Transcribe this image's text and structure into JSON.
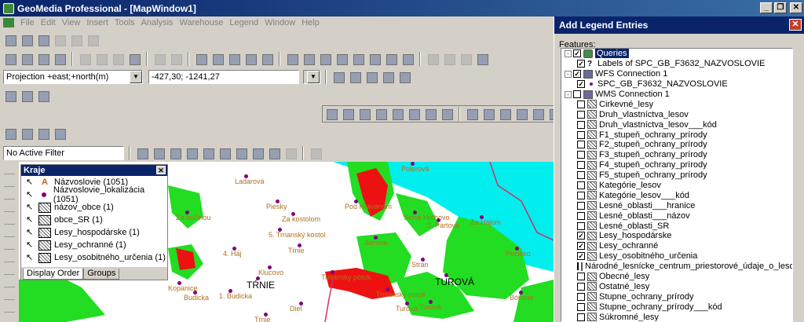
{
  "titlebar": {
    "title": "GeoMedia Professional - [MapWindow1]"
  },
  "menu": [
    "File",
    "Edit",
    "View",
    "Insert",
    "Tools",
    "Analysis",
    "Warehouse",
    "Legend",
    "Window",
    "Help"
  ],
  "coord": {
    "system": "Projection +east;+north(m)",
    "value": "-427,30; -1241,27"
  },
  "filter": {
    "label": "No Active Filter"
  },
  "legend": {
    "title": "Kraje",
    "items": [
      {
        "label": "Názvoslovie (1051)",
        "sym": "A"
      },
      {
        "label": "Názvoslovie_lokalizácia (1051)",
        "sym": ""
      },
      {
        "label": "názov_obce (1)",
        "sym": ""
      },
      {
        "label": "obce_SR (1)",
        "sym": ""
      },
      {
        "label": "Lesy_hospodárske (1)",
        "sym": ""
      },
      {
        "label": "Lesy_ochranné (1)",
        "sym": ""
      },
      {
        "label": "Lesy_osobitného_určenia (1)",
        "sym": ""
      }
    ],
    "tabs": [
      "Display Order",
      "Groups"
    ]
  },
  "map_labels": [
    {
      "t": "Polerová"
    },
    {
      "t": "Ladarová"
    },
    {
      "t": "Piesky"
    },
    {
      "t": "Za bučinou"
    },
    {
      "t": "Za kostolom"
    },
    {
      "t": "Pod Hravanom"
    },
    {
      "t": "Selce Hrchovo"
    },
    {
      "t": "2. Partova"
    },
    {
      "t": "Za Hájom"
    },
    {
      "t": "5. Trnanský kostol"
    },
    {
      "t": "Tŕnie"
    },
    {
      "t": "Jamina"
    },
    {
      "t": "4. Háj"
    },
    {
      "t": "Klucovo"
    },
    {
      "t": "TŔNIE"
    },
    {
      "t": "Trnianský potok"
    },
    {
      "t": "Stran"
    },
    {
      "t": "TUROVÁ"
    },
    {
      "t": "Kopanice"
    },
    {
      "t": "Budicka"
    },
    {
      "t": "1. Budicka"
    },
    {
      "t": "Trnianský potok"
    },
    {
      "t": "Turová"
    },
    {
      "t": "Diel"
    },
    {
      "t": "Turová"
    },
    {
      "t": "Bórovie"
    },
    {
      "t": "Pecisko"
    },
    {
      "t": "Tŕnie"
    }
  ],
  "dialog": {
    "title": "Add Legend Entries",
    "features_label": "Features:",
    "tree": [
      {
        "label": "Queries",
        "level": 0,
        "expand": "-",
        "checked": true,
        "icon": "q",
        "selected": true
      },
      {
        "label": "Labels of SPC_GB_F3632_NAZVOSLOVIE",
        "level": 1,
        "checked": true,
        "icon": "?"
      },
      {
        "label": "WFS Connection 1",
        "level": 0,
        "expand": "-",
        "checked": true,
        "icon": "wfs"
      },
      {
        "label": "SPC_GB_F3632_NAZVOSLOVIE",
        "level": 1,
        "checked": true,
        "icon": "pt"
      },
      {
        "label": "WMS Connection 1",
        "level": 0,
        "expand": "-",
        "checked": false,
        "icon": "wfs"
      },
      {
        "label": "Cirkevné_lesy",
        "level": 1,
        "checked": false,
        "icon": "h"
      },
      {
        "label": "Druh_vlastníctva_lesov",
        "level": 1,
        "checked": false,
        "icon": "h"
      },
      {
        "label": "Druh_vlastníctva_lesov___kód",
        "level": 1,
        "checked": false,
        "icon": "h"
      },
      {
        "label": "F1_stupeň_ochrany_prírody",
        "level": 1,
        "checked": false,
        "icon": "h"
      },
      {
        "label": "F2_stupeň_ochrany_prírody",
        "level": 1,
        "checked": false,
        "icon": "h"
      },
      {
        "label": "F3_stupeň_ochrany_prírody",
        "level": 1,
        "checked": false,
        "icon": "h"
      },
      {
        "label": "F4_stupeň_ochrany_prírody",
        "level": 1,
        "checked": false,
        "icon": "h"
      },
      {
        "label": "F5_stupeň_ochrany_prírody",
        "level": 1,
        "checked": false,
        "icon": "h"
      },
      {
        "label": "Kategórie_lesov",
        "level": 1,
        "checked": false,
        "icon": "h"
      },
      {
        "label": "Kategórie_lesov___kód",
        "level": 1,
        "checked": false,
        "icon": "h"
      },
      {
        "label": "Lesné_oblasti___hranice",
        "level": 1,
        "checked": false,
        "icon": "h"
      },
      {
        "label": "Lesné_oblasti___názov",
        "level": 1,
        "checked": false,
        "icon": "h"
      },
      {
        "label": "Lesné_oblasti_SR",
        "level": 1,
        "checked": false,
        "icon": "h"
      },
      {
        "label": "Lesy_hospodárske",
        "level": 1,
        "checked": true,
        "icon": "h"
      },
      {
        "label": "Lesy_ochranné",
        "level": 1,
        "checked": true,
        "icon": "h"
      },
      {
        "label": "Lesy_osobitného_určenia",
        "level": 1,
        "checked": true,
        "icon": "h"
      },
      {
        "label": "Národné_lesnícke_centrum_priestorové_údaje_o_lesoch_S",
        "level": 1,
        "checked": false,
        "icon": "h"
      },
      {
        "label": "Obecné_lesy",
        "level": 1,
        "checked": false,
        "icon": "h"
      },
      {
        "label": "Ostatné_lesy",
        "level": 1,
        "checked": false,
        "icon": "h"
      },
      {
        "label": "Stupne_ochrany_prírody",
        "level": 1,
        "checked": false,
        "icon": "h"
      },
      {
        "label": "Stupne_ochrany_prírody___kód",
        "level": 1,
        "checked": false,
        "icon": "h"
      },
      {
        "label": "Súkromné_lesy",
        "level": 1,
        "checked": false,
        "icon": "h"
      }
    ]
  },
  "colors": {
    "title": "#0a246a",
    "forest": "#22dd22",
    "protected": "#ee1111",
    "water": "#00eeee",
    "place": "#800080",
    "label": "#b07020"
  }
}
